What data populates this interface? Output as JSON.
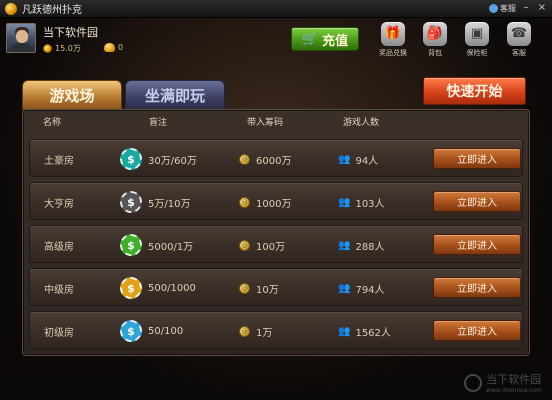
{
  "app": {
    "title": "凡跃德州扑克"
  },
  "titlebar": {
    "service_label": "客服",
    "minimize": "–",
    "close": "×"
  },
  "user": {
    "name": "当下软件园",
    "coins": "15.0万",
    "gold": "0"
  },
  "header": {
    "recharge_label": "充值",
    "icons": [
      {
        "name": "gift-icon",
        "glyph": "🎁",
        "label": "奖品兑换"
      },
      {
        "name": "backpack-icon",
        "glyph": "🎒",
        "label": "背包"
      },
      {
        "name": "safe-icon",
        "glyph": "▣",
        "label": "保险柜"
      },
      {
        "name": "support-icon",
        "glyph": "☎",
        "label": "客服"
      }
    ]
  },
  "tabs": {
    "active": "游戏场",
    "inactive": "坐满即玩"
  },
  "quick_start": "快速开始",
  "table": {
    "headers": {
      "name": "名称",
      "blinds": "盲注",
      "buyin": "带入筹码",
      "players": "游戏人数"
    },
    "rows": [
      {
        "name": "土豪房",
        "blinds": "30万/60万",
        "buyin": "6000万",
        "players": "94人",
        "chip_color": "#1aa8a0",
        "enter": "立即进入"
      },
      {
        "name": "大亨房",
        "blinds": "5万/10万",
        "buyin": "1000万",
        "players": "103人",
        "chip_color": "#555555",
        "enter": "立即进入"
      },
      {
        "name": "高级房",
        "blinds": "5000/1万",
        "buyin": "100万",
        "players": "288人",
        "chip_color": "#3fae2a",
        "enter": "立即进入"
      },
      {
        "name": "中级房",
        "blinds": "500/1000",
        "buyin": "10万",
        "players": "794人",
        "chip_color": "#e0a21a",
        "enter": "立即进入"
      },
      {
        "name": "初级房",
        "blinds": "50/100",
        "buyin": "1万",
        "players": "1562人",
        "chip_color": "#2fa4d6",
        "enter": "立即进入"
      }
    ]
  },
  "watermark": {
    "text": "当下软件园",
    "sub": "www.downxia.com"
  }
}
